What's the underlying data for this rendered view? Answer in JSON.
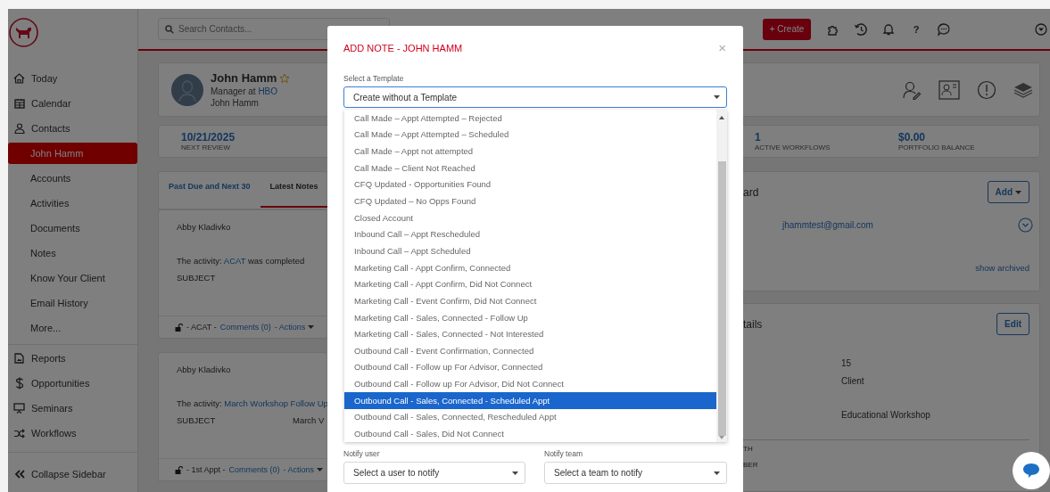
{
  "sidebar": {
    "items": [
      {
        "label": "Today",
        "selected": false
      },
      {
        "label": "Calendar",
        "selected": false
      },
      {
        "label": "Contacts",
        "selected": false,
        "children": [
          {
            "label": "John Hamm",
            "selected": true
          },
          {
            "label": "Accounts",
            "selected": false
          },
          {
            "label": "Activities",
            "selected": false
          },
          {
            "label": "Documents",
            "selected": false
          },
          {
            "label": "Notes",
            "selected": false
          },
          {
            "label": "Know Your Client",
            "selected": false
          },
          {
            "label": "Email History",
            "selected": false
          },
          {
            "label": "More...",
            "selected": false
          }
        ]
      },
      {
        "label": "Reports",
        "selected": false
      },
      {
        "label": "Opportunities",
        "selected": false
      },
      {
        "label": "Seminars",
        "selected": false
      },
      {
        "label": "Workflows",
        "selected": false
      }
    ],
    "collapse": "Collapse Sidebar"
  },
  "topbar": {
    "search": {
      "placeholder": "Search Contacts..."
    },
    "create": "+ Create",
    "help": "?"
  },
  "contact": {
    "name": "John Hamm",
    "title_prefix": "Manager at",
    "company": "HBO",
    "link": "John Hamm"
  },
  "stats": [
    {
      "value": "10/21/2025",
      "label": "NEXT REVIEW"
    },
    {
      "value": "1",
      "label": "ACTIVE WORKFLOWS"
    },
    {
      "value": "$0.00",
      "label": "PORTFOLIO BALANCE"
    }
  ],
  "activity": {
    "tabs": [
      {
        "label": "Past Due and Next 30",
        "selected": false
      },
      {
        "label": "Latest Notes",
        "selected": true
      }
    ],
    "notes": [
      {
        "author": "Abby Kladivko",
        "prefix": "The activity:",
        "link": "ACAT",
        "suffix": "was completed",
        "subject_label": "SUBJECT",
        "tag": "- ACAT -",
        "comments": "Comments (0)",
        "actions": "- Actions"
      },
      {
        "author": "Abby Kladivko",
        "prefix": "The activity:",
        "link": "March Workshop Follow Up",
        "subject_label": "SUBJECT",
        "subject": "March V",
        "tag": "- 1st Appt -",
        "comments": "Comments (0)",
        "actions": "- Actions"
      }
    ]
  },
  "email_card": {
    "title": "ard",
    "add": "Add",
    "email": "jhammtest@gmail.com",
    "show_archived": "show archived"
  },
  "details_card": {
    "title": "tails",
    "edit": "Edit",
    "values": [
      "15",
      "Client",
      "Educational Workshop"
    ],
    "labels": [
      "TH",
      "BER"
    ]
  },
  "modal": {
    "title": "ADD NOTE - JOHN HAMM",
    "close": "×",
    "template_label": "Select a Template",
    "template_value": "Create without a Template",
    "options": [
      {
        "label": "Call Made – Appt Attempted – Rejected",
        "selected": false
      },
      {
        "label": "Call Made – Appt Attempted – Scheduled",
        "selected": false
      },
      {
        "label": "Call Made – Appt not attempted",
        "selected": false
      },
      {
        "label": "Call Made – Client Not Reached",
        "selected": false
      },
      {
        "label": "CFQ Updated - Opportunities Found",
        "selected": false
      },
      {
        "label": "CFQ Updated – No Opps Found",
        "selected": false
      },
      {
        "label": "Closed Account",
        "selected": false
      },
      {
        "label": "Inbound Call – Appt Rescheduled",
        "selected": false
      },
      {
        "label": "Inbound Call – Appt Scheduled",
        "selected": false
      },
      {
        "label": "Marketing Call - Appt Confirm, Connected",
        "selected": false
      },
      {
        "label": "Marketing Call - Appt Confirm, Did Not Connect",
        "selected": false
      },
      {
        "label": "Marketing Call - Event Confirm, Did Not Connect",
        "selected": false
      },
      {
        "label": "Marketing Call - Sales, Connected - Follow Up",
        "selected": false
      },
      {
        "label": "Marketing Call - Sales, Connected - Not Interested",
        "selected": false
      },
      {
        "label": "Outbound Call - Event Confirmation, Connected",
        "selected": false
      },
      {
        "label": "Outbound Call - Follow up For Advisor, Connected",
        "selected": false
      },
      {
        "label": "Outbound Call - Follow up For Advisor, Did Not Connect",
        "selected": false
      },
      {
        "label": "Outbound Call - Sales, Connected - Scheduled Appt",
        "selected": true
      },
      {
        "label": "Outbound Call - Sales, Connected, Rescheduled Appt",
        "selected": false
      },
      {
        "label": "Outbound Call - Sales, Did Not Connect",
        "selected": false
      }
    ],
    "notify_user": {
      "label": "Notify user",
      "placeholder": "Select a user to notify"
    },
    "notify_team": {
      "label": "Notify team",
      "placeholder": "Select a team to notify"
    }
  }
}
